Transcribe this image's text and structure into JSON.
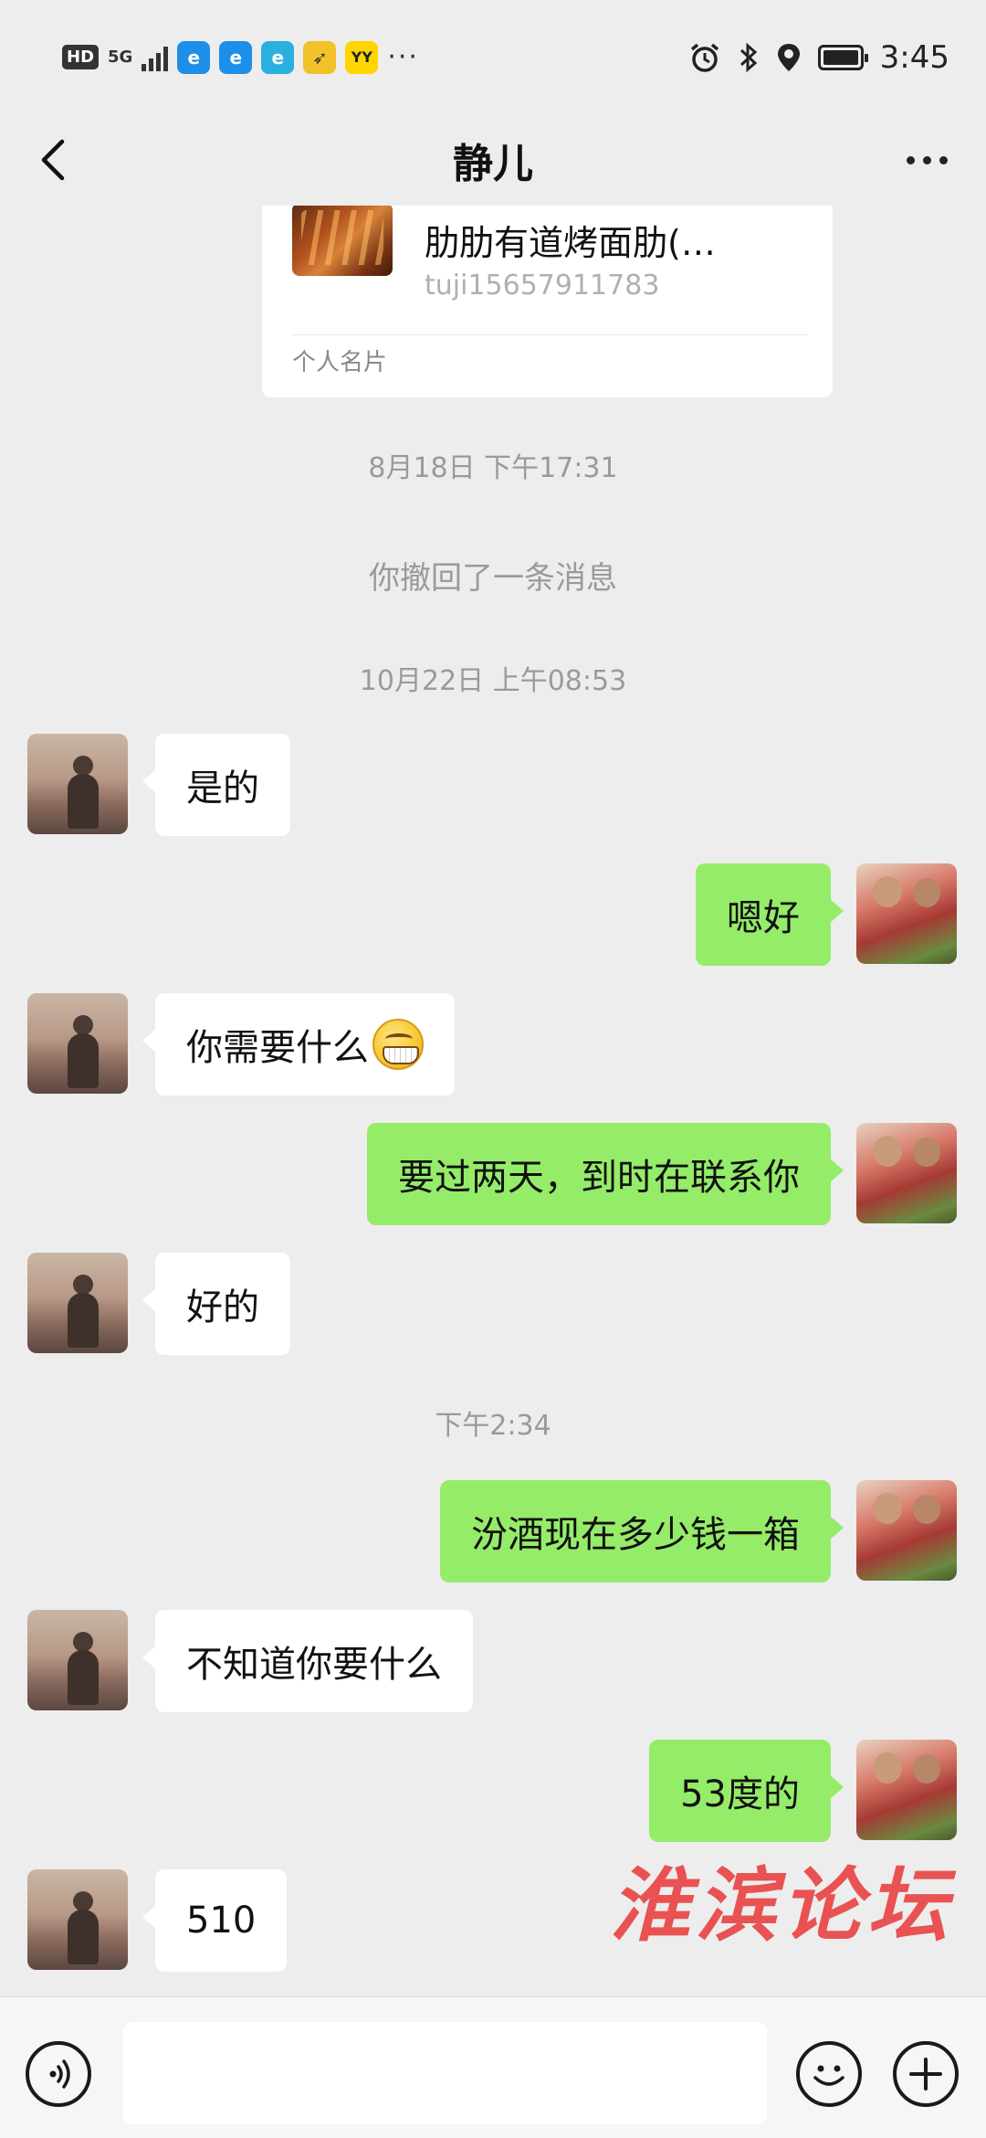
{
  "status_bar": {
    "hd_label": "HD",
    "network": "5G",
    "time": "3:45",
    "overflow_dots": "···",
    "app_icons": [
      "edge-icon",
      "edge-icon",
      "e-app-icon",
      "bird-app-icon",
      "yy-app-icon"
    ],
    "yy_label": "YY"
  },
  "nav": {
    "title": "静儿"
  },
  "contact_card": {
    "name": "肋肋有道烤面肋(…",
    "wechat_id": "tuji15657911783",
    "type_label": "个人名片"
  },
  "messages": {
    "time_1": "8月18日 下午17:31",
    "recall_notice": "你撤回了一条消息",
    "time_2": "10月22日 上午08:53",
    "m1": "是的",
    "m2": "嗯好",
    "m3": "你需要什么",
    "m3_emoji": "grinning-face-emoji",
    "m4": "要过两天，到时在联系你",
    "m5": "好的",
    "time_3": "下午2:34",
    "m6": "汾酒现在多少钱一箱",
    "m7": "不知道你要什么",
    "m8": "53度的",
    "m9": "510"
  },
  "watermark": "淮滨论坛",
  "input_bar": {
    "value": "",
    "placeholder": ""
  },
  "colors": {
    "background": "#ededed",
    "outgoing_bubble": "#95ec69",
    "incoming_bubble": "#ffffff",
    "watermark": "#e83c3c"
  }
}
